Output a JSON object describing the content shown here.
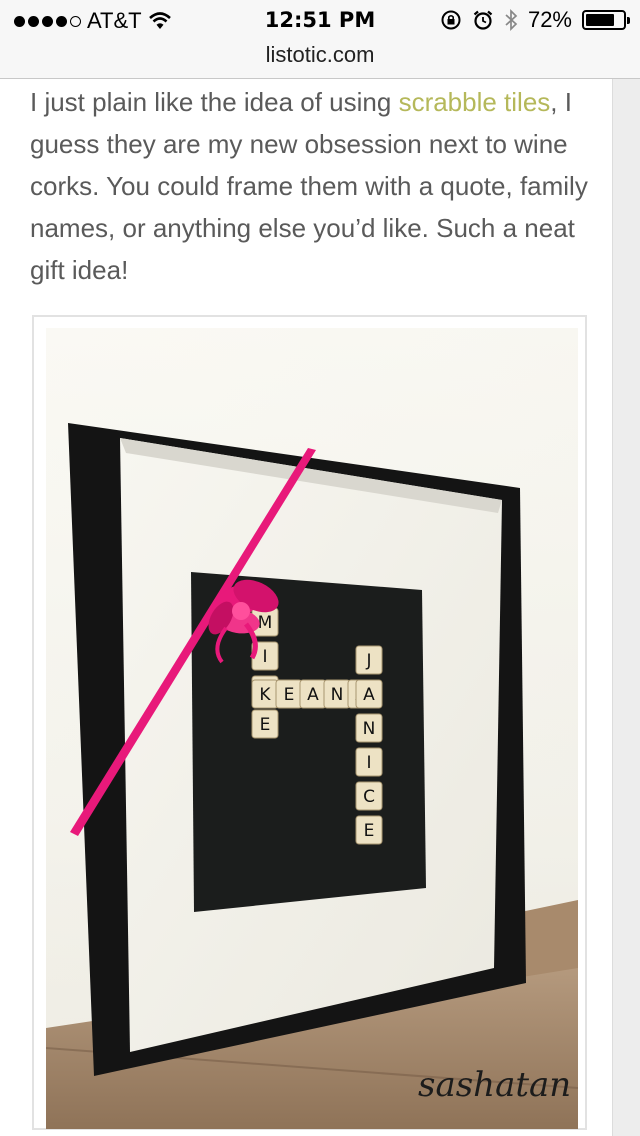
{
  "status_bar": {
    "carrier": "AT&T",
    "time": "12:51 PM",
    "battery": "72%",
    "signal_bars_filled": 4,
    "signal_bars_total": 5
  },
  "browser": {
    "url": "listotic.com"
  },
  "article": {
    "text_before_link": "I just plain like the idea of using ",
    "link_text": "scrabble tiles",
    "text_after_link": ", I guess they are my new obsession next to wine corks. You could frame them with a quote, family names, or anything else you’d like. Such a neat gift idea!"
  },
  "photo": {
    "tiles": {
      "mike": [
        "M",
        "I",
        "K",
        "E"
      ],
      "keana": [
        "K",
        "E",
        "A",
        "N",
        "A"
      ],
      "janice": [
        "J",
        "A",
        "N",
        "I",
        "C",
        "E"
      ]
    },
    "watermark": "sashatan"
  },
  "colors": {
    "link": "#b5b85a",
    "ribbon": "#e8197a",
    "frame": "#141414"
  }
}
